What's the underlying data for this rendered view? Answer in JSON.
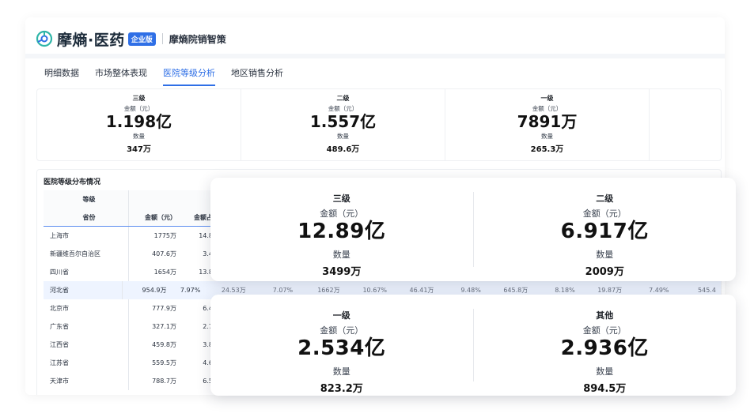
{
  "brand": {
    "name": "摩熵·医药",
    "badge": "企业版",
    "product": "摩熵院销智策"
  },
  "tabs": [
    {
      "label": "明细数据"
    },
    {
      "label": "市场整体表现"
    },
    {
      "label": "医院等级分析"
    },
    {
      "label": "地区销售分析"
    }
  ],
  "kpis": [
    {
      "level": "三级",
      "amount_label": "金额（元）",
      "amount": "1.198亿",
      "qty_label": "数量",
      "qty": "347万"
    },
    {
      "level": "二级",
      "amount_label": "金额（元）",
      "amount": "1.557亿",
      "qty_label": "数量",
      "qty": "489.6万"
    },
    {
      "level": "一级",
      "amount_label": "金额（元）",
      "amount": "7891万",
      "qty_label": "数量",
      "qty": "265.3万"
    }
  ],
  "distribution": {
    "title": "医院等级分布情况",
    "header_level": "等级",
    "header_province": "省份",
    "header_amount": "金额（元）",
    "header_amount_share": "金额占",
    "rows": [
      {
        "province": "上海市",
        "amount": "1775万",
        "share": "14.8"
      },
      {
        "province": "新疆维吾尔自治区",
        "amount": "407.6万",
        "share": "3.4"
      },
      {
        "province": "四川省",
        "amount": "1654万",
        "share": "13.8"
      },
      {
        "province": "河北省",
        "amount": "954.9万",
        "share": "7.97%",
        "extra": [
          "24.53万",
          "7.07%",
          "1662万",
          "10.67%",
          "46.41万",
          "9.48%",
          "645.8万",
          "8.18%",
          "19.87万",
          "7.49%",
          "545.4"
        ]
      },
      {
        "province": "北京市",
        "amount": "777.9万",
        "share": "6.4"
      },
      {
        "province": "广东省",
        "amount": "327.1万",
        "share": "2.7"
      },
      {
        "province": "江西省",
        "amount": "459.8万",
        "share": "3.8"
      },
      {
        "province": "江苏省",
        "amount": "559.5万",
        "share": "4.6"
      },
      {
        "province": "天津市",
        "amount": "788.7万",
        "share": "6.5"
      }
    ]
  },
  "overlay_top": [
    {
      "level": "三级",
      "amount_label": "金额（元）",
      "amount": "12.89亿",
      "qty_label": "数量",
      "qty": "3499万"
    },
    {
      "level": "二级",
      "amount_label": "金额（元）",
      "amount": "6.917亿",
      "qty_label": "数量",
      "qty": "2009万"
    }
  ],
  "overlay_bottom": [
    {
      "level": "一级",
      "amount_label": "金额（元）",
      "amount": "2.534亿",
      "qty_label": "数量",
      "qty": "823.2万"
    },
    {
      "level": "其他",
      "amount_label": "金额（元）",
      "amount": "2.936亿",
      "qty_label": "数量",
      "qty": "894.5万"
    }
  ],
  "icons": {
    "logo": "molecule-logo-icon"
  },
  "colors": {
    "accent": "#2f6fe6",
    "row_alt": "#eef4ff"
  }
}
